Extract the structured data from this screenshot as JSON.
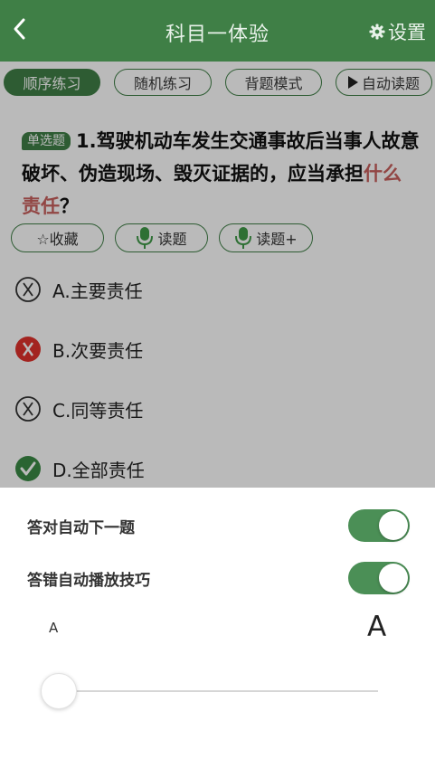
{
  "header": {
    "title": "科目一体验",
    "settings_label": "设置"
  },
  "mode_tabs": [
    {
      "label": "顺序练习",
      "active": true
    },
    {
      "label": "随机练习",
      "active": false
    },
    {
      "label": "背题模式",
      "active": false
    },
    {
      "label": "自动读题",
      "active": false
    }
  ],
  "question": {
    "type_badge": "单选题",
    "text_main": "1.驾驶机动车发生交通事故后当事人故意破坏、伪造现场、毁灭证据的，应当承担",
    "text_highlight": "什么责任",
    "text_end": "？"
  },
  "actions": {
    "favorite": "☆收藏",
    "read": "读题",
    "read_plus": "读题+"
  },
  "options": [
    {
      "label": "A.主要责任",
      "state": "neutral"
    },
    {
      "label": "B.次要责任",
      "state": "wrong"
    },
    {
      "label": "C.同等责任",
      "state": "neutral"
    },
    {
      "label": "D.全部责任",
      "state": "correct"
    }
  ],
  "settings_sheet": {
    "auto_next_label": "答对自动下一题",
    "auto_next_on": true,
    "auto_tip_label": "答错自动播放技巧",
    "auto_tip_on": true,
    "font_small": "A",
    "font_large": "A",
    "font_size_level": 0
  },
  "colors": {
    "primary": "#3f7f46",
    "wrong": "#e0322c",
    "correct": "#3a8a45",
    "highlight": "#c8605e"
  }
}
